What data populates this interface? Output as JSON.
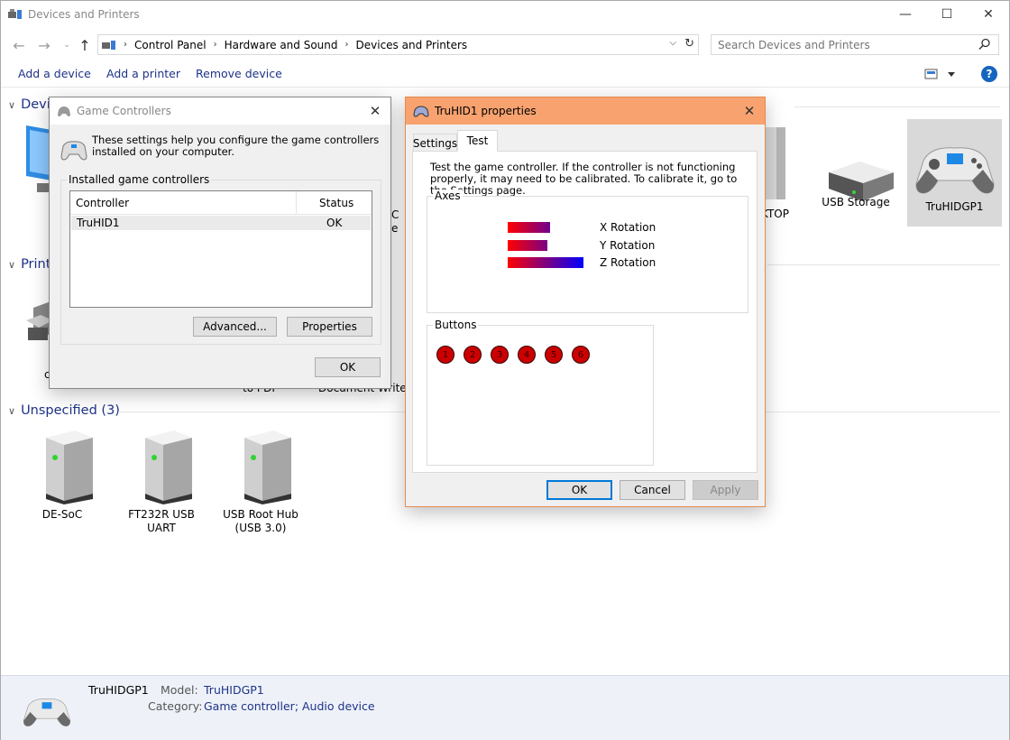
{
  "window": {
    "title": "Devices and Printers",
    "minimize": "—",
    "maximize": "☐",
    "close": "✕"
  },
  "addressbar": {
    "crumbs": [
      "Control Panel",
      "Hardware and Sound",
      "Devices and Printers"
    ],
    "search_placeholder": "Search Devices and Printers"
  },
  "commandbar": {
    "add_device": "Add a device",
    "add_printer": "Add a printer",
    "remove_device": "Remove device",
    "help": "?"
  },
  "groups": {
    "devices_header": "Devices",
    "printers_header": "Printers",
    "unspecified_header": "Unspecified (3)"
  },
  "devices": [
    {
      "label": "USB Storage",
      "icon": "usb-storage-icon"
    },
    {
      "label": "TruHIDGP1",
      "icon": "gamepad-icon"
    }
  ],
  "partial_labels": {
    "c": "c",
    "ktop": "KTOP",
    "ic": "C",
    "e": "e",
    "to_pdf": "to PDF",
    "doc_writer": "Document Writer"
  },
  "unspecified": [
    {
      "label": "DE-SoC"
    },
    {
      "label": "FT232R USB UART"
    },
    {
      "label": "USB Root Hub (USB 3.0)"
    }
  ],
  "details": {
    "name": "TruHIDGP1",
    "model_key": "Model:",
    "model_val": "TruHIDGP1",
    "category_key": "Category:",
    "category_val": "Game controller; Audio device"
  },
  "game_controllers": {
    "title": "Game Controllers",
    "description": "These settings help you configure the game controllers installed on your computer.",
    "installed_label": "Installed game controllers",
    "col_controller": "Controller",
    "col_status": "Status",
    "rows": [
      {
        "controller": "TruHID1",
        "status": "OK"
      }
    ],
    "advanced": "Advanced...",
    "properties": "Properties",
    "ok": "OK"
  },
  "properties": {
    "title": "TruHID1 properties",
    "tab_settings": "Settings",
    "tab_test": "Test",
    "test_text": "Test the game controller.  If the controller is not functioning properly, it may need to be calibrated.  To calibrate it, go to the Settings page.",
    "axes_label": "Axes",
    "axes": [
      {
        "name": "X Rotation",
        "level": 0.56
      },
      {
        "name": "Y Rotation",
        "level": 0.52
      },
      {
        "name": "Z Rotation",
        "level": 1.0
      }
    ],
    "buttons_label": "Buttons",
    "buttons": [
      "1",
      "2",
      "3",
      "4",
      "5",
      "6"
    ],
    "ok": "OK",
    "cancel": "Cancel",
    "apply": "Apply",
    "title_bar_color": "#f7a26f"
  }
}
